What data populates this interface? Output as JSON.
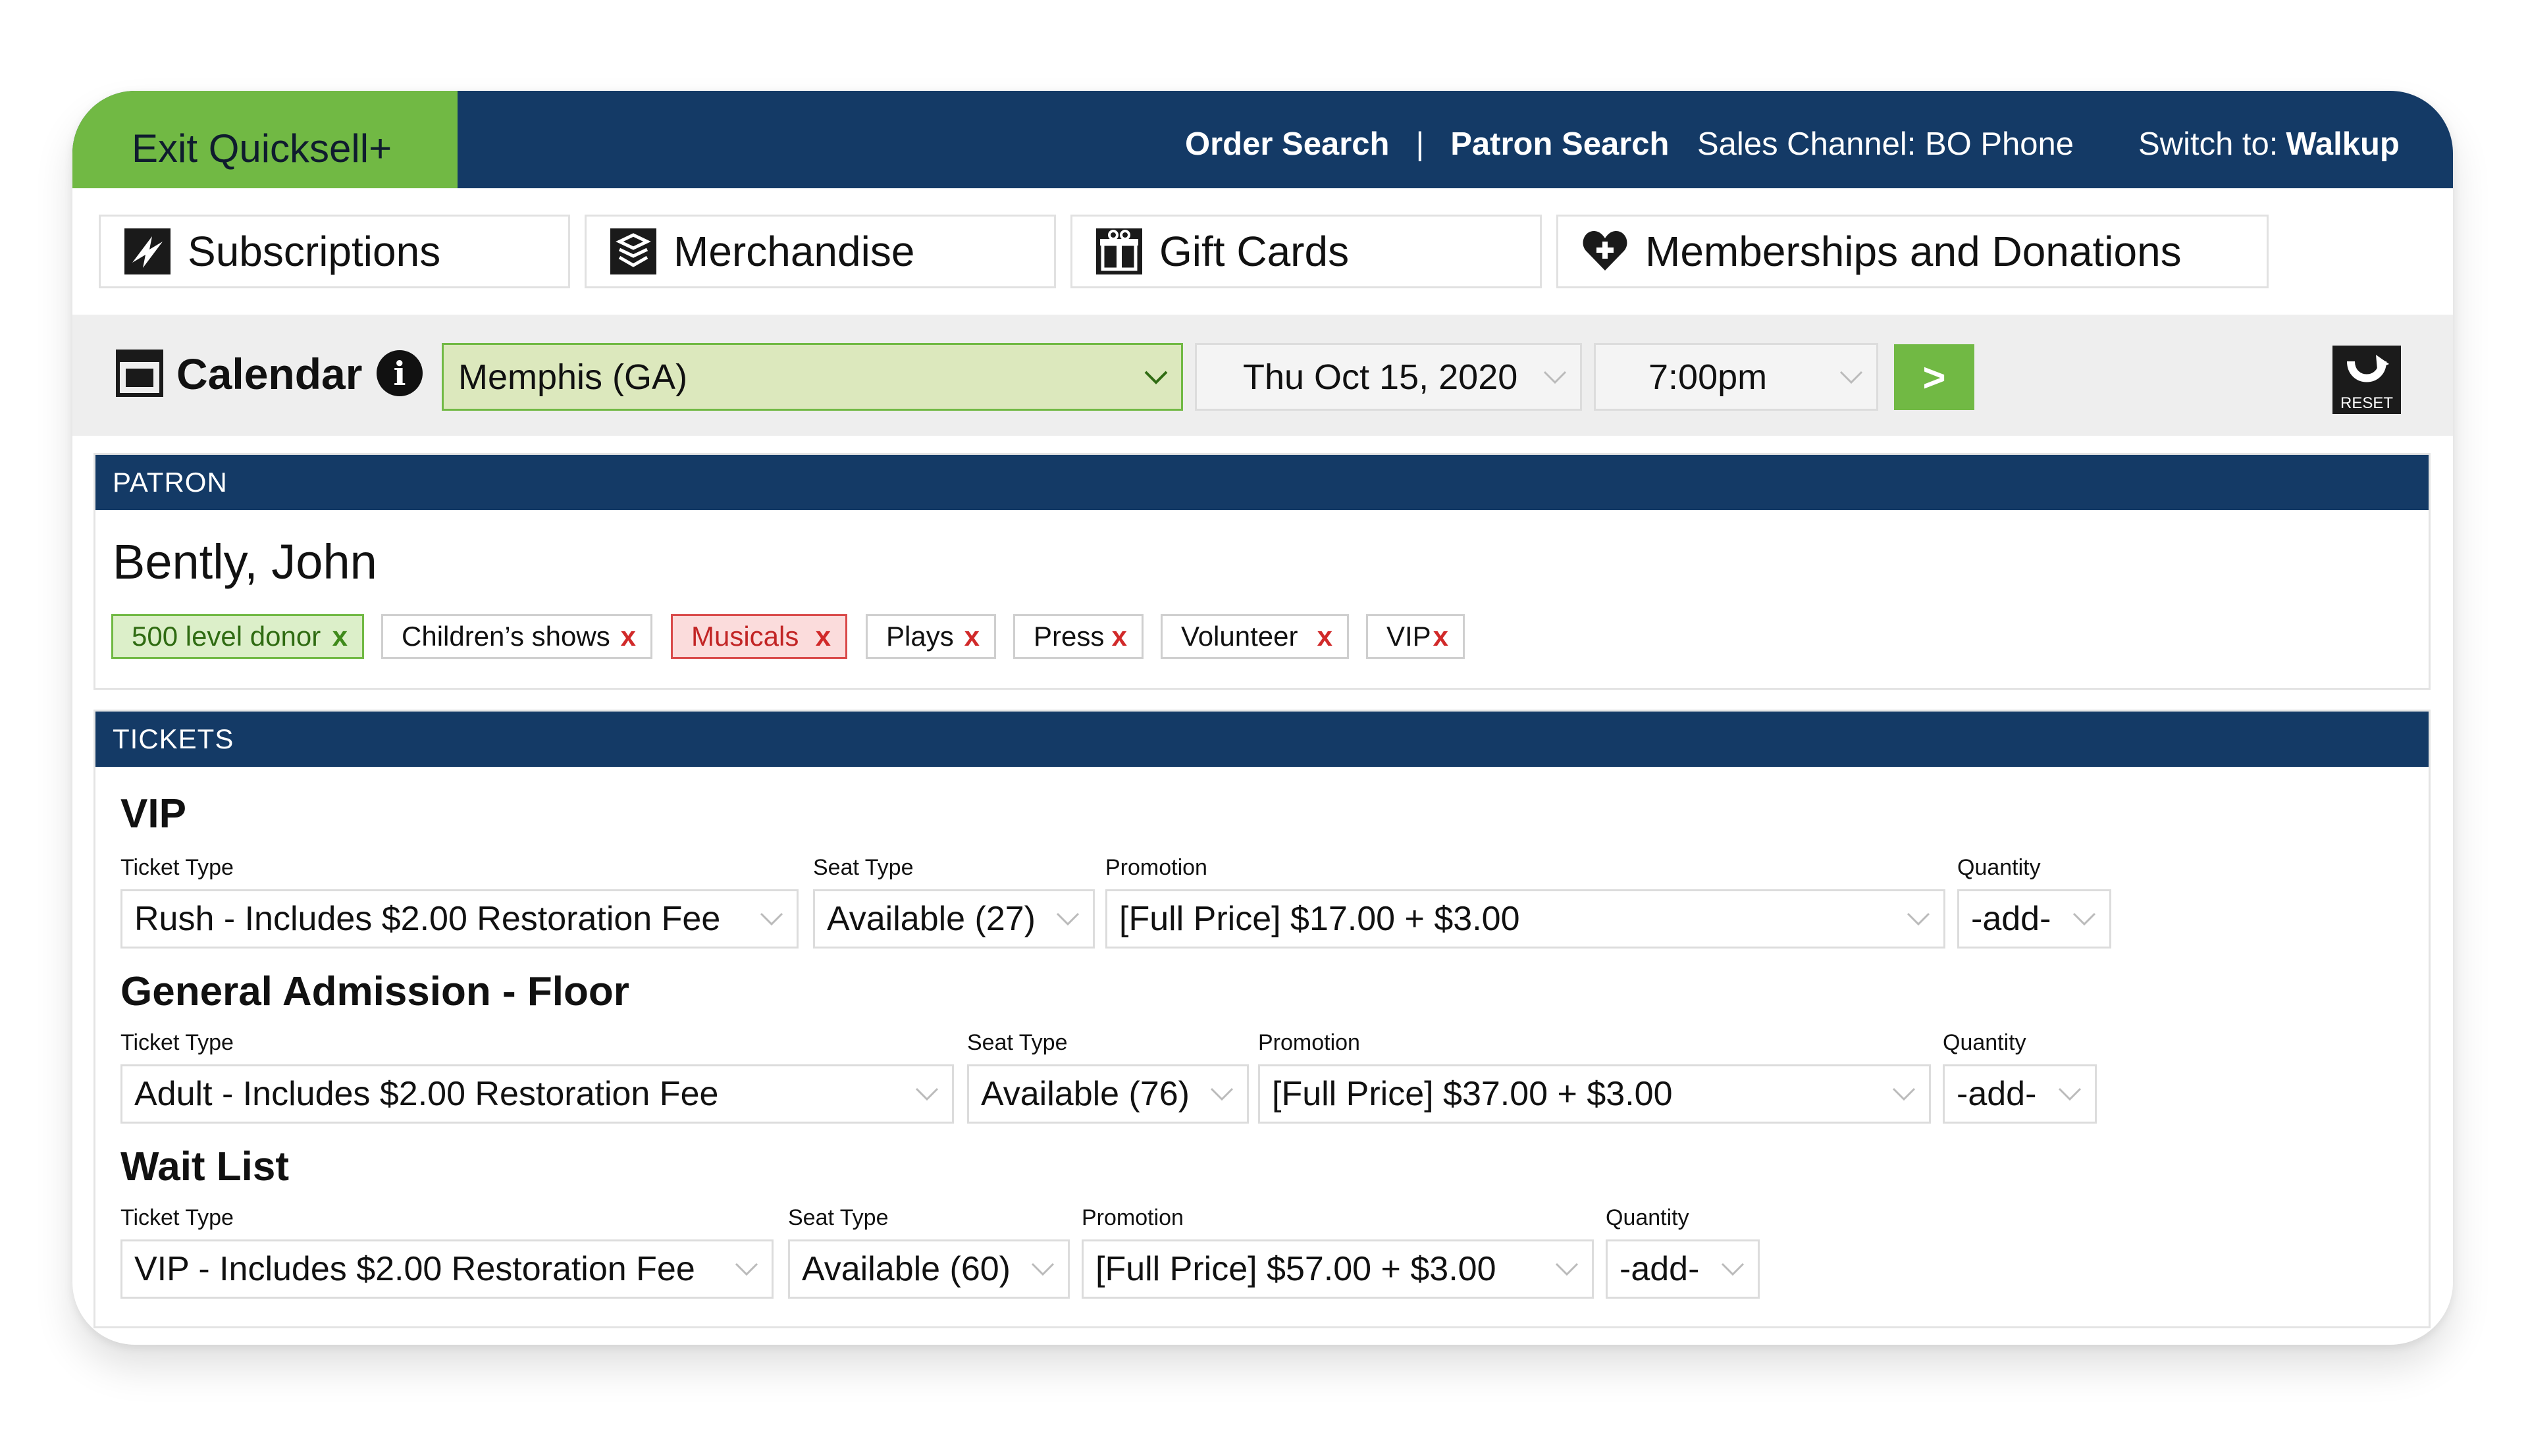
{
  "topbar": {
    "exit_label": "Exit Quicksell+",
    "order_search": "Order Search",
    "separator": "|",
    "patron_search": "Patron Search",
    "sales_channel": "Sales Channel: BO Phone",
    "switch_prefix": "Switch to:",
    "switch_target": "Walkup"
  },
  "tabs": [
    {
      "label": "Subscriptions",
      "icon": "subscriptions-icon"
    },
    {
      "label": "Merchandise",
      "icon": "merchandise-icon"
    },
    {
      "label": "Gift Cards",
      "icon": "gift-card-icon"
    },
    {
      "label": "Memberships and Donations",
      "icon": "heart-plus-icon"
    }
  ],
  "calendar": {
    "label": "Calendar",
    "info_glyph": "i",
    "venue": "Memphis (GA)",
    "date": "Thu Oct 15, 2020",
    "time": "7:00pm",
    "go_label": ">",
    "reset_label": "RESET"
  },
  "patron": {
    "header": "PATRON",
    "name": "Bently, John",
    "tags": [
      {
        "label": "500 level donor",
        "style": "green"
      },
      {
        "label": "Children’s shows",
        "style": "plain"
      },
      {
        "label": "Musicals",
        "style": "red"
      },
      {
        "label": "Plays",
        "style": "plain"
      },
      {
        "label": "Press",
        "style": "plain"
      },
      {
        "label": "Volunteer",
        "style": "plain"
      },
      {
        "label": "VIP",
        "style": "plain"
      }
    ],
    "remove_glyph": "x"
  },
  "tickets": {
    "header": "TICKETS",
    "labels": {
      "ticket_type": "Ticket Type",
      "seat_type": "Seat Type",
      "promotion": "Promotion",
      "quantity": "Quantity"
    },
    "groups": [
      {
        "title": "VIP",
        "ticket_type": "Rush - Includes $2.00 Restoration Fee",
        "seat_type": "Available (27)",
        "promotion": "[Full Price] $17.00 + $3.00",
        "quantity": "-add-"
      },
      {
        "title": "General Admission - Floor",
        "ticket_type": "Adult - Includes $2.00 Restoration Fee",
        "seat_type": "Available (76)",
        "promotion": "[Full Price] $37.00 + $3.00",
        "quantity": "-add-"
      },
      {
        "title": "Wait List",
        "ticket_type": "VIP - Includes $2.00 Restoration Fee",
        "seat_type": "Available (60)",
        "promotion": "[Full Price] $57.00 + $3.00",
        "quantity": "-add-"
      }
    ]
  },
  "colors": {
    "navy": "#143a66",
    "green": "#71b944",
    "venue_bg": "#dce8bd",
    "tag_red": "#c22525"
  }
}
